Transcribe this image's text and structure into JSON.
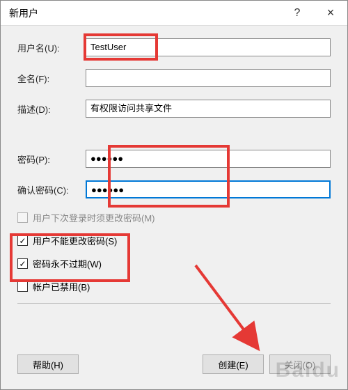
{
  "title": "新用户",
  "titlebar": {
    "help": "?",
    "close": "×"
  },
  "labels": {
    "username": "用户名(U):",
    "fullname": "全名(F):",
    "description": "描述(D):",
    "password": "密码(P):",
    "confirm": "确认密码(C):"
  },
  "fields": {
    "username": "TestUser",
    "fullname": "",
    "description": "有权限访问共享文件",
    "password": "●●●●●●",
    "confirm": "●●●●●●"
  },
  "checks": {
    "must_change": "用户下次登录时须更改密码(M)",
    "cant_change": "用户不能更改密码(S)",
    "never_expire": "密码永不过期(W)",
    "disabled": "帐户已禁用(B)"
  },
  "buttons": {
    "help": "帮助(H)",
    "create": "创建(E)",
    "close": "关闭(O)"
  },
  "check_mark": "✓"
}
